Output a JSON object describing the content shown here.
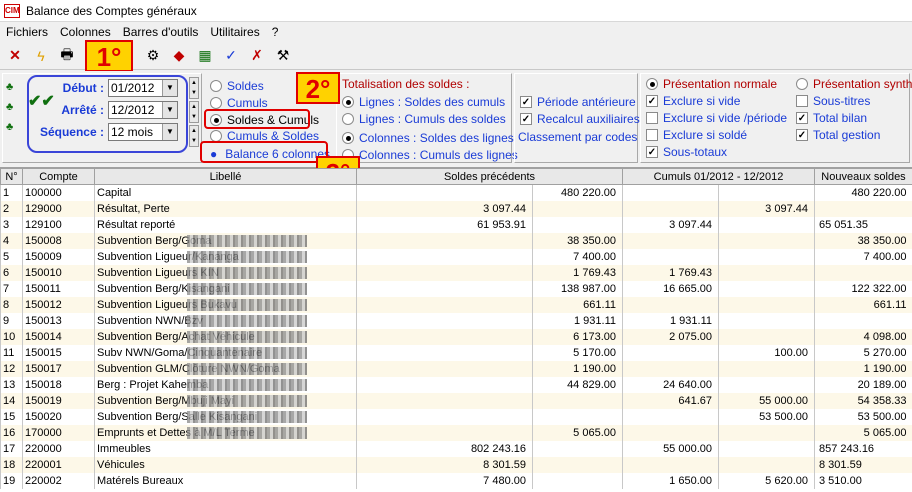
{
  "window": {
    "title": "Balance des Comptes généraux",
    "app_icon": "CIM"
  },
  "menu": [
    "Fichiers",
    "Colonnes",
    "Barres d'outils",
    "Utilitaires",
    "?"
  ],
  "toolbar_icons": [
    "close-icon",
    "bolt-icon",
    "print-icon",
    "view-icon",
    "refresh-icon",
    "filter-icon",
    "eraser-icon",
    "export-icon",
    "check-icon",
    "clear-check-icon",
    "tools-icon"
  ],
  "badges": {
    "b1": "1°",
    "b2": "2°",
    "b3": "3°"
  },
  "period": {
    "debut_label": "Début :",
    "debut_value": "01/2012",
    "arrete_label": "Arrêté :",
    "arrete_value": "12/2012",
    "sequence_label": "Séquence :",
    "sequence_value": "12 mois"
  },
  "mode_radios": {
    "soldes": "Soldes",
    "cumuls": "Cumuls",
    "soldes_cumuls": "Soldes & Cumuls",
    "cumuls_soldes": "Cumuls & Soldes",
    "balance6": "Balance 6 colonnes"
  },
  "totalisation": {
    "header": "Totalisation des soldes :",
    "opt1": "Lignes : Soldes des cumuls",
    "opt2": "Lignes : Cumuls des soldes",
    "opt3": "Colonnes : Soldes des lignes",
    "opt4": "Colonnes : Cumuls des lignes"
  },
  "checks_mid": {
    "periode": "Période antérieure",
    "recalcul": "Recalcul auxiliaires",
    "classement": "Classement par codes"
  },
  "presentation": {
    "normale": "Présentation normale",
    "synthetique": "Présentation synthétique",
    "exclure_vide": "Exclure si vide",
    "sous_titres": "Sous-titres",
    "exclure_vide_periode": "Exclure si vide /période",
    "total_bilan": "Total bilan",
    "exclure_solde": "Exclure si soldé",
    "total_gestion": "Total gestion",
    "sous_totaux": "Sous-totaux"
  },
  "table": {
    "headers": [
      "N°",
      "Compte",
      "Libellé",
      "Soldes précédents",
      "Cumuls 01/2012 - 12/2012",
      "Nouveaux soldes"
    ],
    "rows": [
      [
        "1",
        "100000",
        "Capital",
        "",
        "480 220.00",
        "",
        "",
        "",
        "480 220.00"
      ],
      [
        "2",
        "129000",
        "Résultat, Perte",
        "3 097.44",
        "",
        "",
        "3 097.44",
        "",
        ""
      ],
      [
        "3",
        "129100",
        "Résultat reporté",
        "61 953.91",
        "",
        "3 097.44",
        "",
        "65 051.35",
        ""
      ],
      [
        "4",
        "150008",
        "Subvention Berg/Goma",
        "",
        "38 350.00",
        "",
        "",
        "",
        "38 350.00"
      ],
      [
        "5",
        "150009",
        "Subvention Ligueur/Kananga",
        "",
        "7 400.00",
        "",
        "",
        "",
        "7 400.00"
      ],
      [
        "6",
        "150010",
        "Subvention Ligueurs KIN",
        "",
        "1 769.43",
        "1 769.43",
        "",
        "",
        ""
      ],
      [
        "7",
        "150011",
        "Subvention Berg/Kisangani",
        "",
        "138 987.00",
        "16 665.00",
        "",
        "",
        "122 322.00"
      ],
      [
        "8",
        "150012",
        "Subvention Ligueurs Bukavu",
        "",
        "661.11",
        "",
        "",
        "",
        "661.11"
      ],
      [
        "9",
        "150013",
        "Subvention NWN/Bzv",
        "",
        "1 931.11",
        "1 931.11",
        "",
        "",
        ""
      ],
      [
        "10",
        "150014",
        "Subvention Berg/Achat Véhicule",
        "",
        "6 173.00",
        "2 075.00",
        "",
        "",
        "4 098.00"
      ],
      [
        "11",
        "150015",
        "Subv NWN/Goma/Cinquantenaire",
        "",
        "5 170.00",
        "",
        "100.00",
        "",
        "5 270.00"
      ],
      [
        "12",
        "150017",
        "Subvention GLM/Clôture NWN/Goma",
        "",
        "1 190.00",
        "",
        "",
        "",
        "1 190.00"
      ],
      [
        "13",
        "150018",
        "Berg : Projet Kahemba",
        "",
        "44 829.00",
        "24 640.00",
        "",
        "",
        "20 189.00"
      ],
      [
        "14",
        "150019",
        "Subvention Berg/Mbuji Mayi",
        "",
        "",
        "641.67",
        "55 000.00",
        "",
        "54 358.33"
      ],
      [
        "15",
        "150020",
        "Subvention Berg/Salle Kisangani",
        "",
        "",
        "",
        "53 500.00",
        "",
        "53 500.00"
      ],
      [
        "16",
        "170000",
        "Emprunts et Dettes à M/L Terme",
        "",
        "5 065.00",
        "",
        "",
        "",
        "5 065.00"
      ],
      [
        "17",
        "220000",
        "Immeubles",
        "802 243.16",
        "",
        "55 000.00",
        "",
        "857 243.16",
        ""
      ],
      [
        "18",
        "220001",
        "Véhicules",
        "8 301.59",
        "",
        "",
        "",
        "8 301.59",
        ""
      ],
      [
        "19",
        "220002",
        "Matérels Bureaux",
        "7 480.00",
        "",
        "1 650.00",
        "5 620.00",
        "3 510.00",
        ""
      ]
    ]
  }
}
